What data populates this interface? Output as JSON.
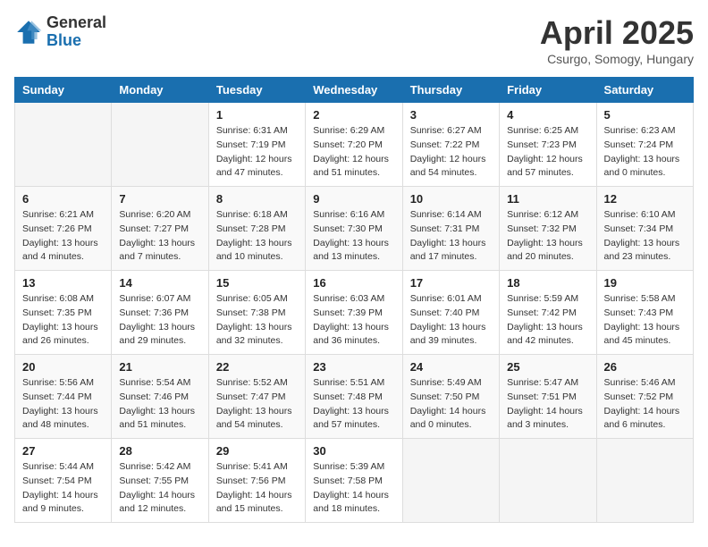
{
  "logo": {
    "general": "General",
    "blue": "Blue"
  },
  "title": "April 2025",
  "location": "Csurgo, Somogy, Hungary",
  "weekdays": [
    "Sunday",
    "Monday",
    "Tuesday",
    "Wednesday",
    "Thursday",
    "Friday",
    "Saturday"
  ],
  "weeks": [
    [
      null,
      null,
      {
        "day": "1",
        "sunrise": "Sunrise: 6:31 AM",
        "sunset": "Sunset: 7:19 PM",
        "daylight": "Daylight: 12 hours and 47 minutes."
      },
      {
        "day": "2",
        "sunrise": "Sunrise: 6:29 AM",
        "sunset": "Sunset: 7:20 PM",
        "daylight": "Daylight: 12 hours and 51 minutes."
      },
      {
        "day": "3",
        "sunrise": "Sunrise: 6:27 AM",
        "sunset": "Sunset: 7:22 PM",
        "daylight": "Daylight: 12 hours and 54 minutes."
      },
      {
        "day": "4",
        "sunrise": "Sunrise: 6:25 AM",
        "sunset": "Sunset: 7:23 PM",
        "daylight": "Daylight: 12 hours and 57 minutes."
      },
      {
        "day": "5",
        "sunrise": "Sunrise: 6:23 AM",
        "sunset": "Sunset: 7:24 PM",
        "daylight": "Daylight: 13 hours and 0 minutes."
      }
    ],
    [
      {
        "day": "6",
        "sunrise": "Sunrise: 6:21 AM",
        "sunset": "Sunset: 7:26 PM",
        "daylight": "Daylight: 13 hours and 4 minutes."
      },
      {
        "day": "7",
        "sunrise": "Sunrise: 6:20 AM",
        "sunset": "Sunset: 7:27 PM",
        "daylight": "Daylight: 13 hours and 7 minutes."
      },
      {
        "day": "8",
        "sunrise": "Sunrise: 6:18 AM",
        "sunset": "Sunset: 7:28 PM",
        "daylight": "Daylight: 13 hours and 10 minutes."
      },
      {
        "day": "9",
        "sunrise": "Sunrise: 6:16 AM",
        "sunset": "Sunset: 7:30 PM",
        "daylight": "Daylight: 13 hours and 13 minutes."
      },
      {
        "day": "10",
        "sunrise": "Sunrise: 6:14 AM",
        "sunset": "Sunset: 7:31 PM",
        "daylight": "Daylight: 13 hours and 17 minutes."
      },
      {
        "day": "11",
        "sunrise": "Sunrise: 6:12 AM",
        "sunset": "Sunset: 7:32 PM",
        "daylight": "Daylight: 13 hours and 20 minutes."
      },
      {
        "day": "12",
        "sunrise": "Sunrise: 6:10 AM",
        "sunset": "Sunset: 7:34 PM",
        "daylight": "Daylight: 13 hours and 23 minutes."
      }
    ],
    [
      {
        "day": "13",
        "sunrise": "Sunrise: 6:08 AM",
        "sunset": "Sunset: 7:35 PM",
        "daylight": "Daylight: 13 hours and 26 minutes."
      },
      {
        "day": "14",
        "sunrise": "Sunrise: 6:07 AM",
        "sunset": "Sunset: 7:36 PM",
        "daylight": "Daylight: 13 hours and 29 minutes."
      },
      {
        "day": "15",
        "sunrise": "Sunrise: 6:05 AM",
        "sunset": "Sunset: 7:38 PM",
        "daylight": "Daylight: 13 hours and 32 minutes."
      },
      {
        "day": "16",
        "sunrise": "Sunrise: 6:03 AM",
        "sunset": "Sunset: 7:39 PM",
        "daylight": "Daylight: 13 hours and 36 minutes."
      },
      {
        "day": "17",
        "sunrise": "Sunrise: 6:01 AM",
        "sunset": "Sunset: 7:40 PM",
        "daylight": "Daylight: 13 hours and 39 minutes."
      },
      {
        "day": "18",
        "sunrise": "Sunrise: 5:59 AM",
        "sunset": "Sunset: 7:42 PM",
        "daylight": "Daylight: 13 hours and 42 minutes."
      },
      {
        "day": "19",
        "sunrise": "Sunrise: 5:58 AM",
        "sunset": "Sunset: 7:43 PM",
        "daylight": "Daylight: 13 hours and 45 minutes."
      }
    ],
    [
      {
        "day": "20",
        "sunrise": "Sunrise: 5:56 AM",
        "sunset": "Sunset: 7:44 PM",
        "daylight": "Daylight: 13 hours and 48 minutes."
      },
      {
        "day": "21",
        "sunrise": "Sunrise: 5:54 AM",
        "sunset": "Sunset: 7:46 PM",
        "daylight": "Daylight: 13 hours and 51 minutes."
      },
      {
        "day": "22",
        "sunrise": "Sunrise: 5:52 AM",
        "sunset": "Sunset: 7:47 PM",
        "daylight": "Daylight: 13 hours and 54 minutes."
      },
      {
        "day": "23",
        "sunrise": "Sunrise: 5:51 AM",
        "sunset": "Sunset: 7:48 PM",
        "daylight": "Daylight: 13 hours and 57 minutes."
      },
      {
        "day": "24",
        "sunrise": "Sunrise: 5:49 AM",
        "sunset": "Sunset: 7:50 PM",
        "daylight": "Daylight: 14 hours and 0 minutes."
      },
      {
        "day": "25",
        "sunrise": "Sunrise: 5:47 AM",
        "sunset": "Sunset: 7:51 PM",
        "daylight": "Daylight: 14 hours and 3 minutes."
      },
      {
        "day": "26",
        "sunrise": "Sunrise: 5:46 AM",
        "sunset": "Sunset: 7:52 PM",
        "daylight": "Daylight: 14 hours and 6 minutes."
      }
    ],
    [
      {
        "day": "27",
        "sunrise": "Sunrise: 5:44 AM",
        "sunset": "Sunset: 7:54 PM",
        "daylight": "Daylight: 14 hours and 9 minutes."
      },
      {
        "day": "28",
        "sunrise": "Sunrise: 5:42 AM",
        "sunset": "Sunset: 7:55 PM",
        "daylight": "Daylight: 14 hours and 12 minutes."
      },
      {
        "day": "29",
        "sunrise": "Sunrise: 5:41 AM",
        "sunset": "Sunset: 7:56 PM",
        "daylight": "Daylight: 14 hours and 15 minutes."
      },
      {
        "day": "30",
        "sunrise": "Sunrise: 5:39 AM",
        "sunset": "Sunset: 7:58 PM",
        "daylight": "Daylight: 14 hours and 18 minutes."
      },
      null,
      null,
      null
    ]
  ]
}
